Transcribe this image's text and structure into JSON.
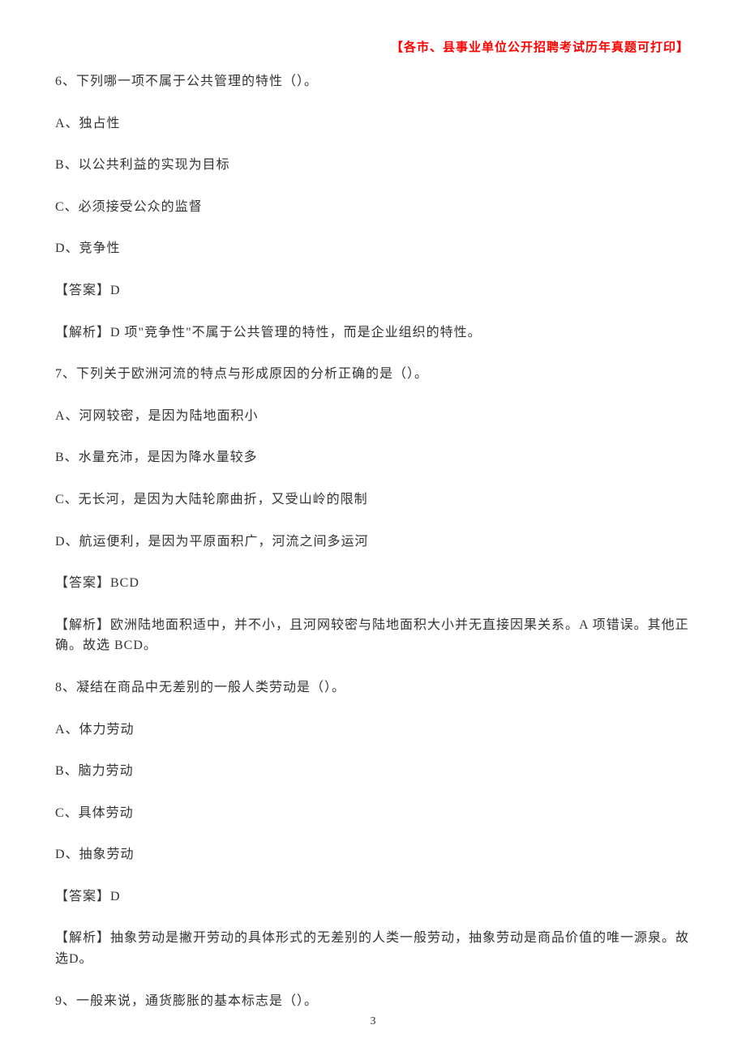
{
  "header": "【各市、县事业单位公开招聘考试历年真题可打印】",
  "q6": {
    "stem": "6、下列哪一项不属于公共管理的特性（）。",
    "A": "A、独占性",
    "B": "B、以公共利益的实现为目标",
    "C": "C、必须接受公众的监督",
    "D": "D、竞争性",
    "answer": "【答案】D",
    "analysis": "【解析】D 项\"竞争性\"不属于公共管理的特性，而是企业组织的特性。"
  },
  "q7": {
    "stem": "7、下列关于欧洲河流的特点与形成原因的分析正确的是（）。",
    "A": "A、河网较密，是因为陆地面积小",
    "B": "B、水量充沛，是因为降水量较多",
    "C": "C、无长河，是因为大陆轮廓曲折，又受山岭的限制",
    "D": "D、航运便利，是因为平原面积广，河流之间多运河",
    "answer": "【答案】BCD",
    "analysis": "【解析】欧洲陆地面积适中，并不小，且河网较密与陆地面积大小并无直接因果关系。A 项错误。其他正确。故选 BCD。"
  },
  "q8": {
    "stem": "8、凝结在商品中无差别的一般人类劳动是（）。",
    "A": "A、体力劳动",
    "B": "B、脑力劳动",
    "C": "C、具体劳动",
    "D": "D、抽象劳动",
    "answer": "【答案】D",
    "analysis": "【解析】抽象劳动是撇开劳动的具体形式的无差别的人类一般劳动，抽象劳动是商品价值的唯一源泉。故选D。"
  },
  "q9": {
    "stem": "9、一般来说，通货膨胀的基本标志是（）。"
  },
  "pageNumber": "3"
}
